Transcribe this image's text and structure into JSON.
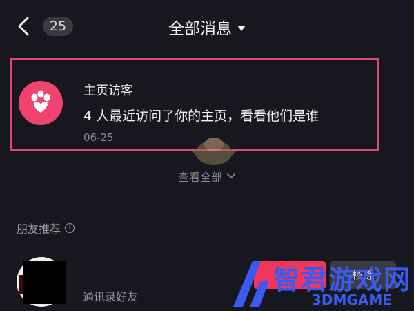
{
  "header": {
    "badge_count": "25",
    "title": "全部消息"
  },
  "visitor_card": {
    "title": "主页访客",
    "description": "4 人最近访问了你的主页，看看他们是谁",
    "date": "06-25"
  },
  "view_all": {
    "label": "查看全部"
  },
  "friends": {
    "section_title": "朋友推荐",
    "items": [
      {
        "name": "通讯录好友",
        "follow_label": "",
        "remove_label": "移除"
      }
    ]
  },
  "watermark": {
    "text": "智君游戏网",
    "sub": "3DMGAME"
  },
  "colors": {
    "background": "#17181f",
    "accent_pink": "#f0436f",
    "highlight_border": "#e0467a",
    "watermark_blue": "#3b5bf0"
  }
}
